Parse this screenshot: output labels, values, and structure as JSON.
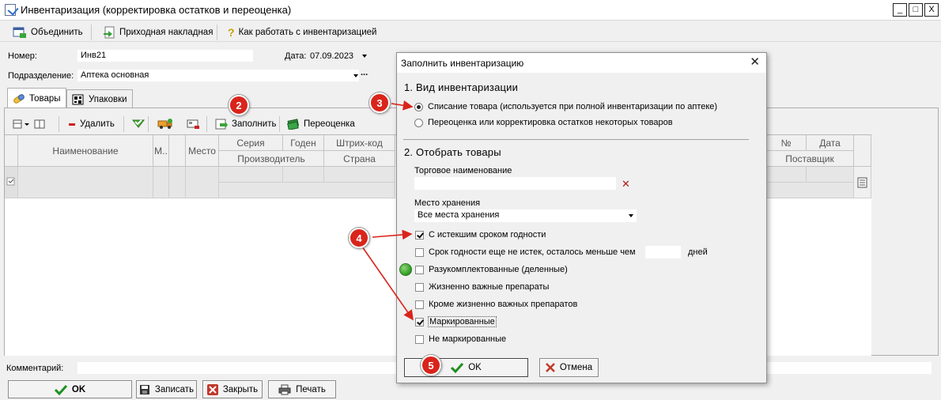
{
  "window": {
    "title": "Инвентаризация (корректировка остатков и переоценка)",
    "min": "_",
    "max": "□",
    "close": "X"
  },
  "toolbar": {
    "merge": "Объединить",
    "invoice": "Приходная накладная",
    "help": "Как работать с инвентаризацией",
    "help_glyph": "?"
  },
  "form": {
    "number_label": "Номер:",
    "number_value": "Инв21",
    "date_label": "Дата:",
    "date_value": "07.09.2023",
    "dept_label": "Подразделение:",
    "dept_value": "Аптека основная",
    "dept_more": "..."
  },
  "tabs": {
    "goods": "Товары",
    "packs": "Упаковки"
  },
  "grid_toolbar": {
    "delete": "Удалить",
    "fill": "Заполнить",
    "reprice": "Переоценка"
  },
  "grid": {
    "col_name": "Наименование",
    "col_m": "М..",
    "col_place": "Место",
    "col_series": "Серия",
    "col_valid": "Годен",
    "col_barcode": "Штрих-код",
    "col_producer": "Производитель",
    "col_country": "Страна",
    "col_no": "№",
    "col_date": "Дата",
    "col_supplier": "Поставщик"
  },
  "bottom": {
    "comment_label": "Комментарий:",
    "ok": "OK",
    "save": "Записать",
    "close": "Закрыть",
    "print": "Печать"
  },
  "dialog": {
    "title": "Заполнить инвентаризацию",
    "close": "✕",
    "section1": "1. Вид инвентаризации",
    "radio_writeoff": "Списание товара (используется при полной инвентаризации по аптеке)",
    "radio_reprice": "Переоценка или корректировка остатков некоторых товаров",
    "section2": "2. Отобрать товары",
    "trade_name_label": "Торговое наименование",
    "trade_name_value": "",
    "clear_glyph": "✕",
    "storage_label": "Место хранения",
    "storage_value": "Все места хранения",
    "cb_expired": "С истекшим сроком годности",
    "cb_expiring": "Срок годности еще не истек, осталось меньше чем",
    "days_value": "",
    "days_label": "дней",
    "cb_split": "Разукомплектованные (деленные)",
    "cb_vital": "Жизненно важные препараты",
    "cb_except_vital": "Кроме жизненно важных препаратов",
    "cb_marked": "Маркированные",
    "cb_unmarked": "Не маркированные",
    "ok": "OK",
    "cancel": "Отмена"
  },
  "state": {
    "writeoff_selected": true,
    "expired_checked": true,
    "marked_checked": true
  },
  "badges": [
    "2",
    "3",
    "4",
    "5"
  ],
  "colors": {
    "badge": "#d9241b",
    "arrow": "#d9241b",
    "ok_check": "#1e8f1e",
    "cancel_x": "#c0392b",
    "status_dot": "#39a52b"
  }
}
